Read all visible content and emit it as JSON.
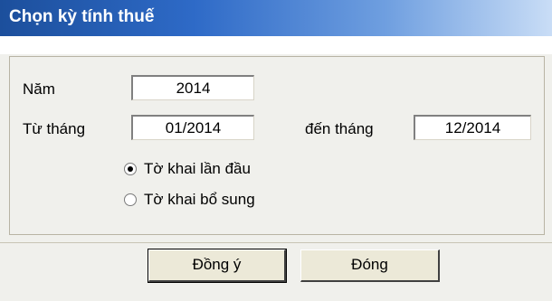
{
  "window": {
    "title": "Chọn kỳ tính thuế"
  },
  "form": {
    "year_label": "Năm",
    "year_value": "2014",
    "from_label": "Từ tháng",
    "from_value": "01/2014",
    "to_label": "đến tháng",
    "to_value": "12/2014"
  },
  "radios": [
    {
      "label": "Tờ khai lần đầu",
      "checked": true
    },
    {
      "label": "Tờ khai bổ sung",
      "checked": false
    }
  ],
  "buttons": {
    "ok_label": "Đồng ý",
    "close_label": "Đóng"
  }
}
